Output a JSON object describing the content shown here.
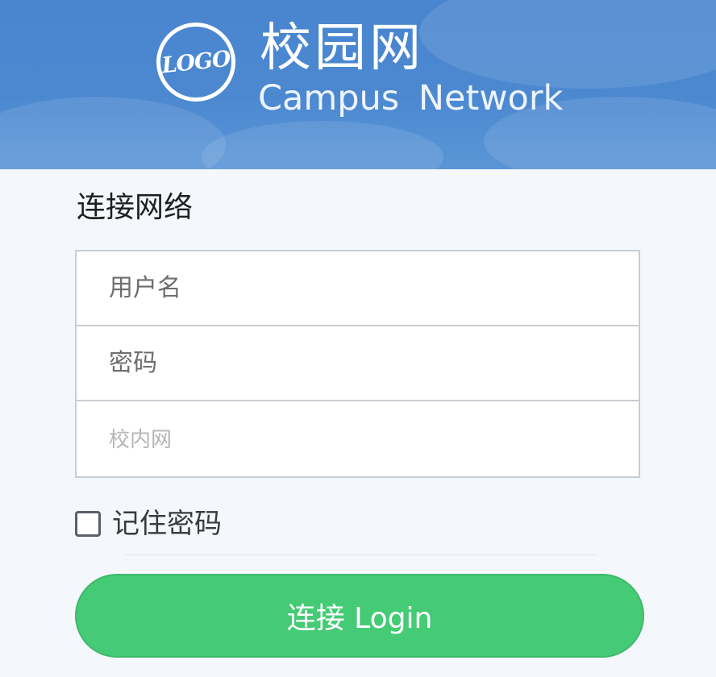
{
  "header": {
    "logo_text": "LOGO",
    "brand_cn": "校园网",
    "brand_en": "Campus Network",
    "bg_color": "#4a86cf"
  },
  "form": {
    "title": "连接网络",
    "username_placeholder": "用户名",
    "password_placeholder": "密码",
    "network_placeholder": "校内网",
    "remember_label": "记住密码",
    "remember_checked": false,
    "login_label": "连接 Login",
    "login_color": "#45cb76"
  }
}
